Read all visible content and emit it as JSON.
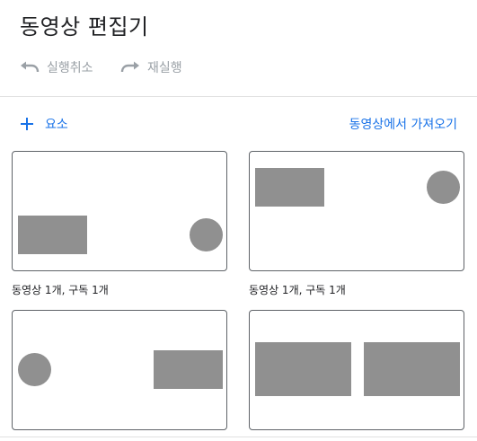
{
  "header": {
    "title": "동영상 편집기"
  },
  "history": {
    "undo_label": "실행취소",
    "redo_label": "재실행"
  },
  "toolbar": {
    "add_element_label": "요소",
    "import_video_label": "동영상에서 가져오기"
  },
  "layouts": [
    {
      "caption": "동영상 1개, 구독 1개"
    },
    {
      "caption": "동영상 1개, 구독 1개"
    },
    {
      "caption": ""
    },
    {
      "caption": ""
    }
  ],
  "colors": {
    "accent": "#1a73e8",
    "placeholder_shape": "#909090",
    "disabled_text": "#9aa0a6"
  }
}
